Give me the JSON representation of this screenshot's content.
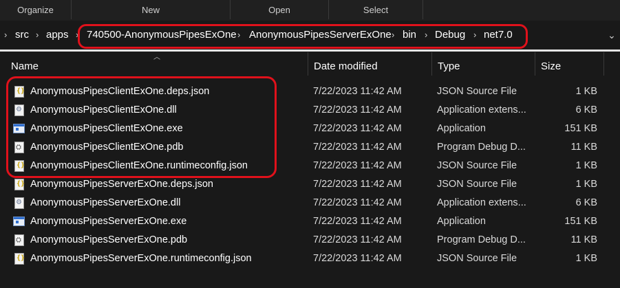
{
  "ribbon": {
    "groups": [
      "Organize",
      "New",
      "Open",
      "Select"
    ]
  },
  "address": {
    "crumbs": [
      "src",
      "apps",
      "740500-AnonymousPipesExOne",
      "AnonymousPipesServerExOne",
      "bin",
      "Debug",
      "net7.0"
    ],
    "separator_icon": "chevron-right-icon",
    "dropdown_icon": "chevron-down-icon"
  },
  "columns": {
    "name": "Name",
    "date": "Date modified",
    "type": "Type",
    "size": "Size",
    "sort_icon": "sort-ascending-icon"
  },
  "files": [
    {
      "name": "AnonymousPipesClientExOne.deps.json",
      "date": "7/22/2023 11:42 AM",
      "type": "JSON Source File",
      "size": "1 KB",
      "icon": "json-file-icon"
    },
    {
      "name": "AnonymousPipesClientExOne.dll",
      "date": "7/22/2023 11:42 AM",
      "type": "Application extens...",
      "size": "6 KB",
      "icon": "dll-file-icon"
    },
    {
      "name": "AnonymousPipesClientExOne.exe",
      "date": "7/22/2023 11:42 AM",
      "type": "Application",
      "size": "151 KB",
      "icon": "exe-file-icon"
    },
    {
      "name": "AnonymousPipesClientExOne.pdb",
      "date": "7/22/2023 11:42 AM",
      "type": "Program Debug D...",
      "size": "11 KB",
      "icon": "pdb-file-icon"
    },
    {
      "name": "AnonymousPipesClientExOne.runtimeconfig.json",
      "date": "7/22/2023 11:42 AM",
      "type": "JSON Source File",
      "size": "1 KB",
      "icon": "json-file-icon"
    },
    {
      "name": "AnonymousPipesServerExOne.deps.json",
      "date": "7/22/2023 11:42 AM",
      "type": "JSON Source File",
      "size": "1 KB",
      "icon": "json-file-icon"
    },
    {
      "name": "AnonymousPipesServerExOne.dll",
      "date": "7/22/2023 11:42 AM",
      "type": "Application extens...",
      "size": "6 KB",
      "icon": "dll-file-icon"
    },
    {
      "name": "AnonymousPipesServerExOne.exe",
      "date": "7/22/2023 11:42 AM",
      "type": "Application",
      "size": "151 KB",
      "icon": "exe-file-icon"
    },
    {
      "name": "AnonymousPipesServerExOne.pdb",
      "date": "7/22/2023 11:42 AM",
      "type": "Program Debug D...",
      "size": "11 KB",
      "icon": "pdb-file-icon"
    },
    {
      "name": "AnonymousPipesServerExOne.runtimeconfig.json",
      "date": "7/22/2023 11:42 AM",
      "type": "JSON Source File",
      "size": "1 KB",
      "icon": "json-file-icon"
    }
  ],
  "colors": {
    "background": "#191919",
    "annotation_red": "#e0111b",
    "text": "#ffffff"
  }
}
